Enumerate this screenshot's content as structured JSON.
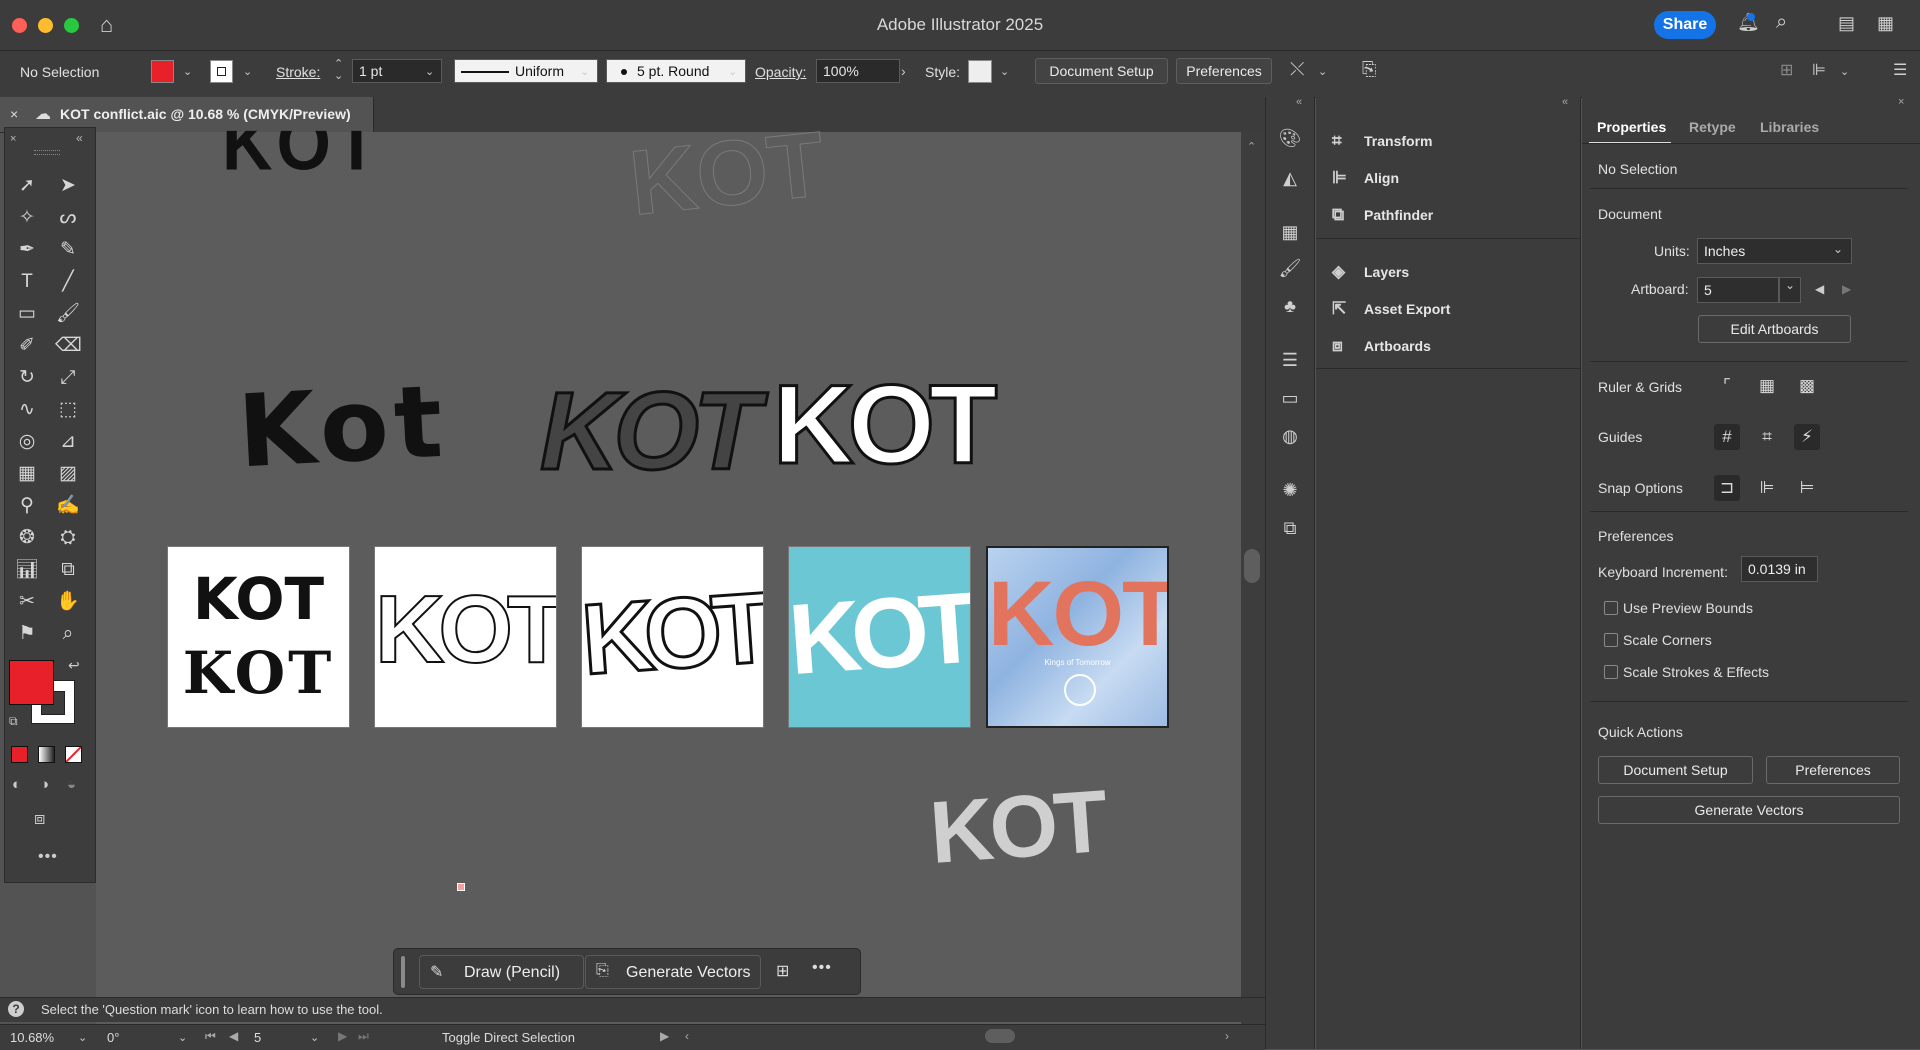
{
  "titlebar": {
    "title": "Adobe Illustrator 2025",
    "share": "Share"
  },
  "control": {
    "selection": "No Selection",
    "fill_color": "#e8202a",
    "stroke_label": "Stroke:",
    "stroke_value": "1 pt",
    "profile": "Uniform",
    "brush": "5 pt. Round",
    "opacity_label": "Opacity:",
    "opacity_value": "100%",
    "style_label": "Style:",
    "document_setup": "Document Setup",
    "preferences": "Preferences"
  },
  "tab": {
    "title": "KOT conflict.aic @ 10.68 % (CMYK/Preview)"
  },
  "canvas": {
    "big_marks": [
      "KOT",
      "Kot",
      "KOT",
      "KOT",
      "KOT"
    ],
    "artboards": [
      {
        "line1": "KOT",
        "line2": "KOT",
        "bg": "#ffffff",
        "color": "#111111"
      },
      {
        "line1": "KOT",
        "bg": "#ffffff",
        "color": "#111111"
      },
      {
        "line1": "KOT",
        "bg": "#ffffff",
        "color": "#111111"
      },
      {
        "line1": "KOT",
        "bg": "#6cc7d4",
        "color": "#ffffff"
      },
      {
        "line1": "KOT",
        "bg": "#a9c6e8",
        "color": "#e2735d",
        "sub": "Kings of Tomorrow"
      }
    ]
  },
  "ctxbar": {
    "draw": "Draw (Pencil)",
    "generate": "Generate Vectors"
  },
  "status": {
    "hint": "Select the 'Question mark' icon to learn how to use the tool.",
    "zoom": "10.68%",
    "rotation": "0°",
    "artboard": "5",
    "tool": "Toggle Direct Selection"
  },
  "panels": {
    "items": [
      "Transform",
      "Align",
      "Pathfinder",
      "Layers",
      "Asset Export",
      "Artboards"
    ]
  },
  "props": {
    "tabs": [
      "Properties",
      "Retype",
      "Libraries"
    ],
    "no_selection": "No Selection",
    "document": "Document",
    "units_label": "Units:",
    "units_value": "Inches",
    "artboard_label": "Artboard:",
    "artboard_value": "5",
    "edit_artboards": "Edit Artboards",
    "ruler_grids": "Ruler & Grids",
    "guides": "Guides",
    "snap_options": "Snap Options",
    "preferences": "Preferences",
    "keyboard_increment_label": "Keyboard Increment:",
    "keyboard_increment_value": "0.0139 in",
    "use_preview_bounds": "Use Preview Bounds",
    "scale_corners": "Scale Corners",
    "scale_strokes": "Scale Strokes & Effects",
    "quick_actions": "Quick Actions",
    "document_setup": "Document Setup",
    "preferences_btn": "Preferences",
    "generate_vectors": "Generate Vectors"
  }
}
